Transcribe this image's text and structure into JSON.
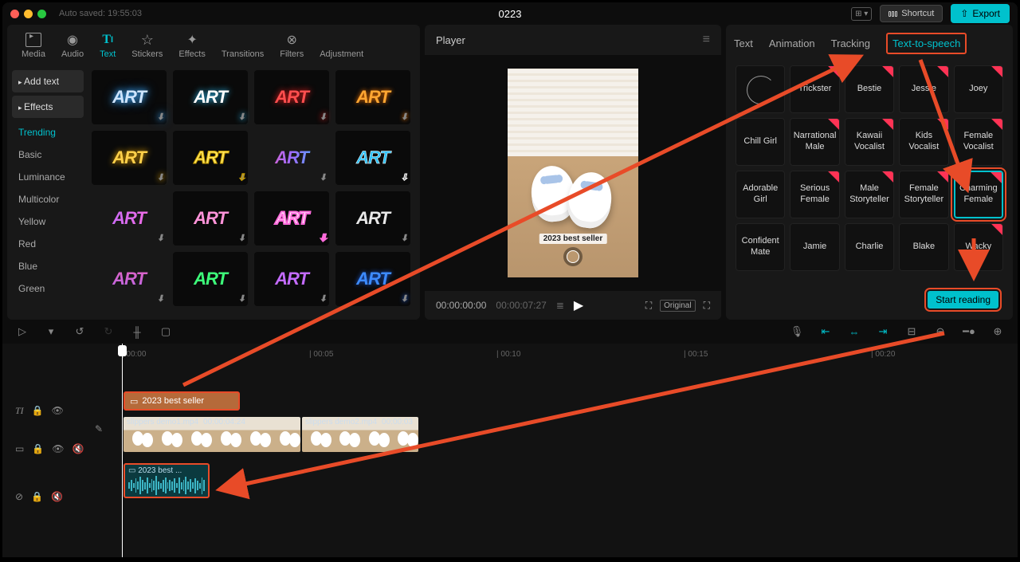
{
  "titlebar": {
    "autosave": "Auto saved: 19:55:03",
    "title": "0223",
    "shortcut": "Shortcut",
    "export": "Export"
  },
  "toolTabs": [
    {
      "id": "media",
      "label": "Media"
    },
    {
      "id": "audio",
      "label": "Audio"
    },
    {
      "id": "text",
      "label": "Text"
    },
    {
      "id": "stickers",
      "label": "Stickers"
    },
    {
      "id": "effects",
      "label": "Effects"
    },
    {
      "id": "transitions",
      "label": "Transitions"
    },
    {
      "id": "filters",
      "label": "Filters"
    },
    {
      "id": "adjustment",
      "label": "Adjustment"
    }
  ],
  "leftNav": {
    "addText": "Add text",
    "effects": "Effects",
    "cats": [
      "Trending",
      "Basic",
      "Luminance",
      "Multicolor",
      "Yellow",
      "Red",
      "Blue",
      "Green"
    ]
  },
  "assetLabel": "ART",
  "player": {
    "title": "Player",
    "pos": "00:00:00:00",
    "dur": "00:00:07:27",
    "caption": "2023 best seller",
    "ratio": "Original"
  },
  "rightTabs": [
    "Text",
    "Animation",
    "Tracking",
    "Text-to-speech"
  ],
  "voices": [
    {
      "label": "",
      "clock": true
    },
    {
      "label": "Trickster",
      "r": true
    },
    {
      "label": "Bestie",
      "r": true
    },
    {
      "label": "Jessie",
      "r": true
    },
    {
      "label": "Joey",
      "r": true
    },
    {
      "label": "Chill Girl"
    },
    {
      "label": "Narrational Male",
      "r": true
    },
    {
      "label": "Kawaii Vocalist",
      "r": true
    },
    {
      "label": "Kids Vocalist",
      "r": true
    },
    {
      "label": "Female Vocalist",
      "r": true
    },
    {
      "label": "Adorable Girl"
    },
    {
      "label": "Serious Female",
      "r": true
    },
    {
      "label": "Male Storyteller",
      "r": true
    },
    {
      "label": "Female Storyteller",
      "r": true
    },
    {
      "label": "Charming Female",
      "r": true,
      "sel": true
    },
    {
      "label": "Confident Mate"
    },
    {
      "label": "Jamie"
    },
    {
      "label": "Charlie"
    },
    {
      "label": "Blake"
    },
    {
      "label": "Wacky",
      "r": true
    }
  ],
  "startReading": "Start reading",
  "ruler": [
    "00:00",
    "00:05",
    "00:10",
    "00:15",
    "00:20"
  ],
  "clips": {
    "text": "2023 best seller",
    "v1": {
      "name": "slippers demo1.mp4",
      "dur": "00:00:04:24"
    },
    "v2": {
      "name": "slippers demo2.mp4",
      "dur": "00:00:03"
    },
    "audio": "2023 best ..."
  }
}
